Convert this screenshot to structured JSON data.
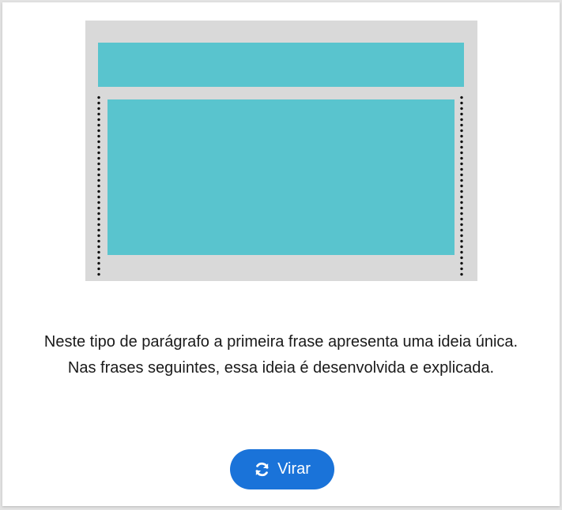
{
  "colors": {
    "accent": "#1a73d9",
    "teal_block": "#59c4ce",
    "illustration_bg": "#d9d9d9"
  },
  "illustration": {
    "type": "paragraph-structure-diagram"
  },
  "text": {
    "line1": "Neste tipo de parágrafo a primeira frase apresenta uma ideia única.",
    "line2": "Nas frases seguintes, essa ideia é desenvolvida e explicada."
  },
  "button": {
    "label": "Virar",
    "icon": "refresh-icon"
  }
}
